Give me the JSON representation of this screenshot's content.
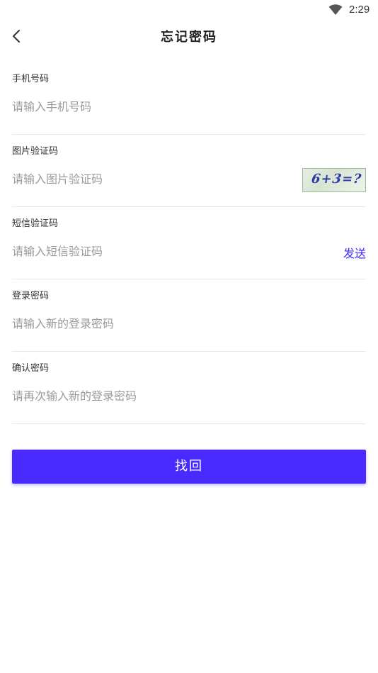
{
  "status_bar": {
    "time": "2:29",
    "wifi_icon": "wifi-icon"
  },
  "header": {
    "back_icon": "chevron-left-icon",
    "title": "忘记密码"
  },
  "form": {
    "phone": {
      "label": "手机号码",
      "placeholder": "请输入手机号码"
    },
    "image_captcha": {
      "label": "图片验证码",
      "placeholder": "请输入图片验证码",
      "captcha_text": "6+3=?"
    },
    "sms_code": {
      "label": "短信验证码",
      "placeholder": "请输入短信验证码",
      "send_label": "发送"
    },
    "password": {
      "label": "登录密码",
      "placeholder": "请输入新的登录密码"
    },
    "confirm_password": {
      "label": "确认密码",
      "placeholder": "请再次输入新的登录密码"
    }
  },
  "submit_label": "找回",
  "colors": {
    "accent": "#4a2bff",
    "link": "#3d2bff",
    "placeholder": "#9a9a9a",
    "divider": "#e8e8e8"
  }
}
